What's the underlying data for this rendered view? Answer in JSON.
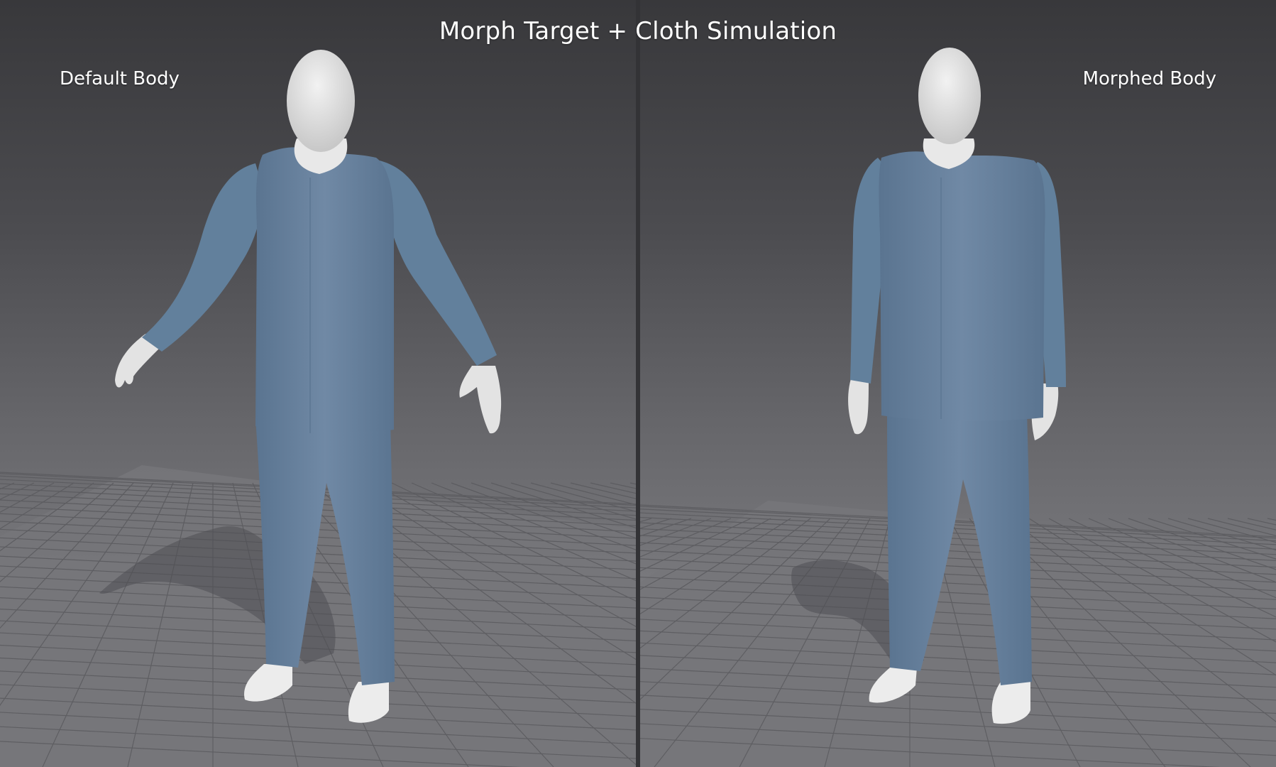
{
  "title": "Morph Target + Cloth Simulation",
  "viewports": {
    "left": {
      "label": "Default Body"
    },
    "right": {
      "label": "Morphed Body"
    }
  },
  "colors": {
    "cloth": "#6b86a3",
    "cloth_dark": "#566f8a",
    "skin": "#e6e6e6",
    "grid_line": "#5a5a5e",
    "background_top": "#38383b",
    "background_bottom": "#808084"
  }
}
